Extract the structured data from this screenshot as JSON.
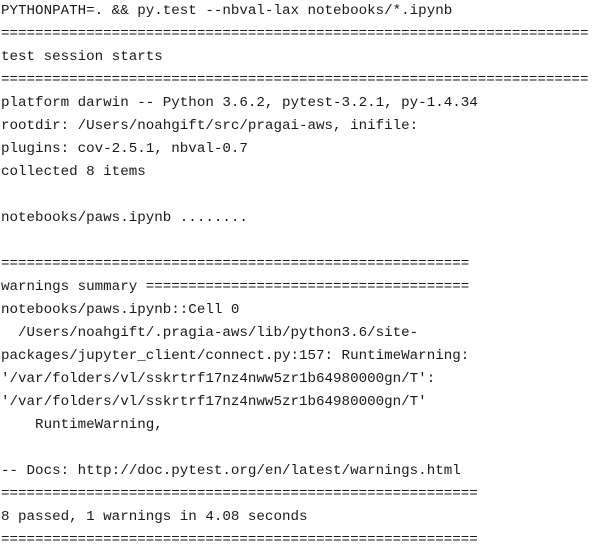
{
  "terminal": {
    "lines": [
      "PYTHONPATH=. && py.test --nbval-lax notebooks/*.ipynb",
      "=====================================================================",
      "test session starts",
      "=====================================================================",
      "platform darwin -- Python 3.6.2, pytest-3.2.1, py-1.4.34",
      "rootdir: /Users/noahgift/src/pragai-aws, inifile:",
      "plugins: cov-2.5.1, nbval-0.7",
      "collected 8 items",
      "",
      "notebooks/paws.ipynb ........",
      "",
      "=======================================================",
      "warnings summary ======================================",
      "notebooks/paws.ipynb::Cell 0",
      "  /Users/noahgift/.pragia-aws/lib/python3.6/site-",
      "packages/jupyter_client/connect.py:157: RuntimeWarning:",
      "'/var/folders/vl/sskrtrf17nz4nww5zr1b64980000gn/T':",
      "'/var/folders/vl/sskrtrf17nz4nww5zr1b64980000gn/T'",
      "    RuntimeWarning,",
      "",
      "-- Docs: http://doc.pytest.org/en/latest/warnings.html",
      "========================================================",
      "8 passed, 1 warnings in 4.08 seconds",
      "========================================================"
    ]
  }
}
